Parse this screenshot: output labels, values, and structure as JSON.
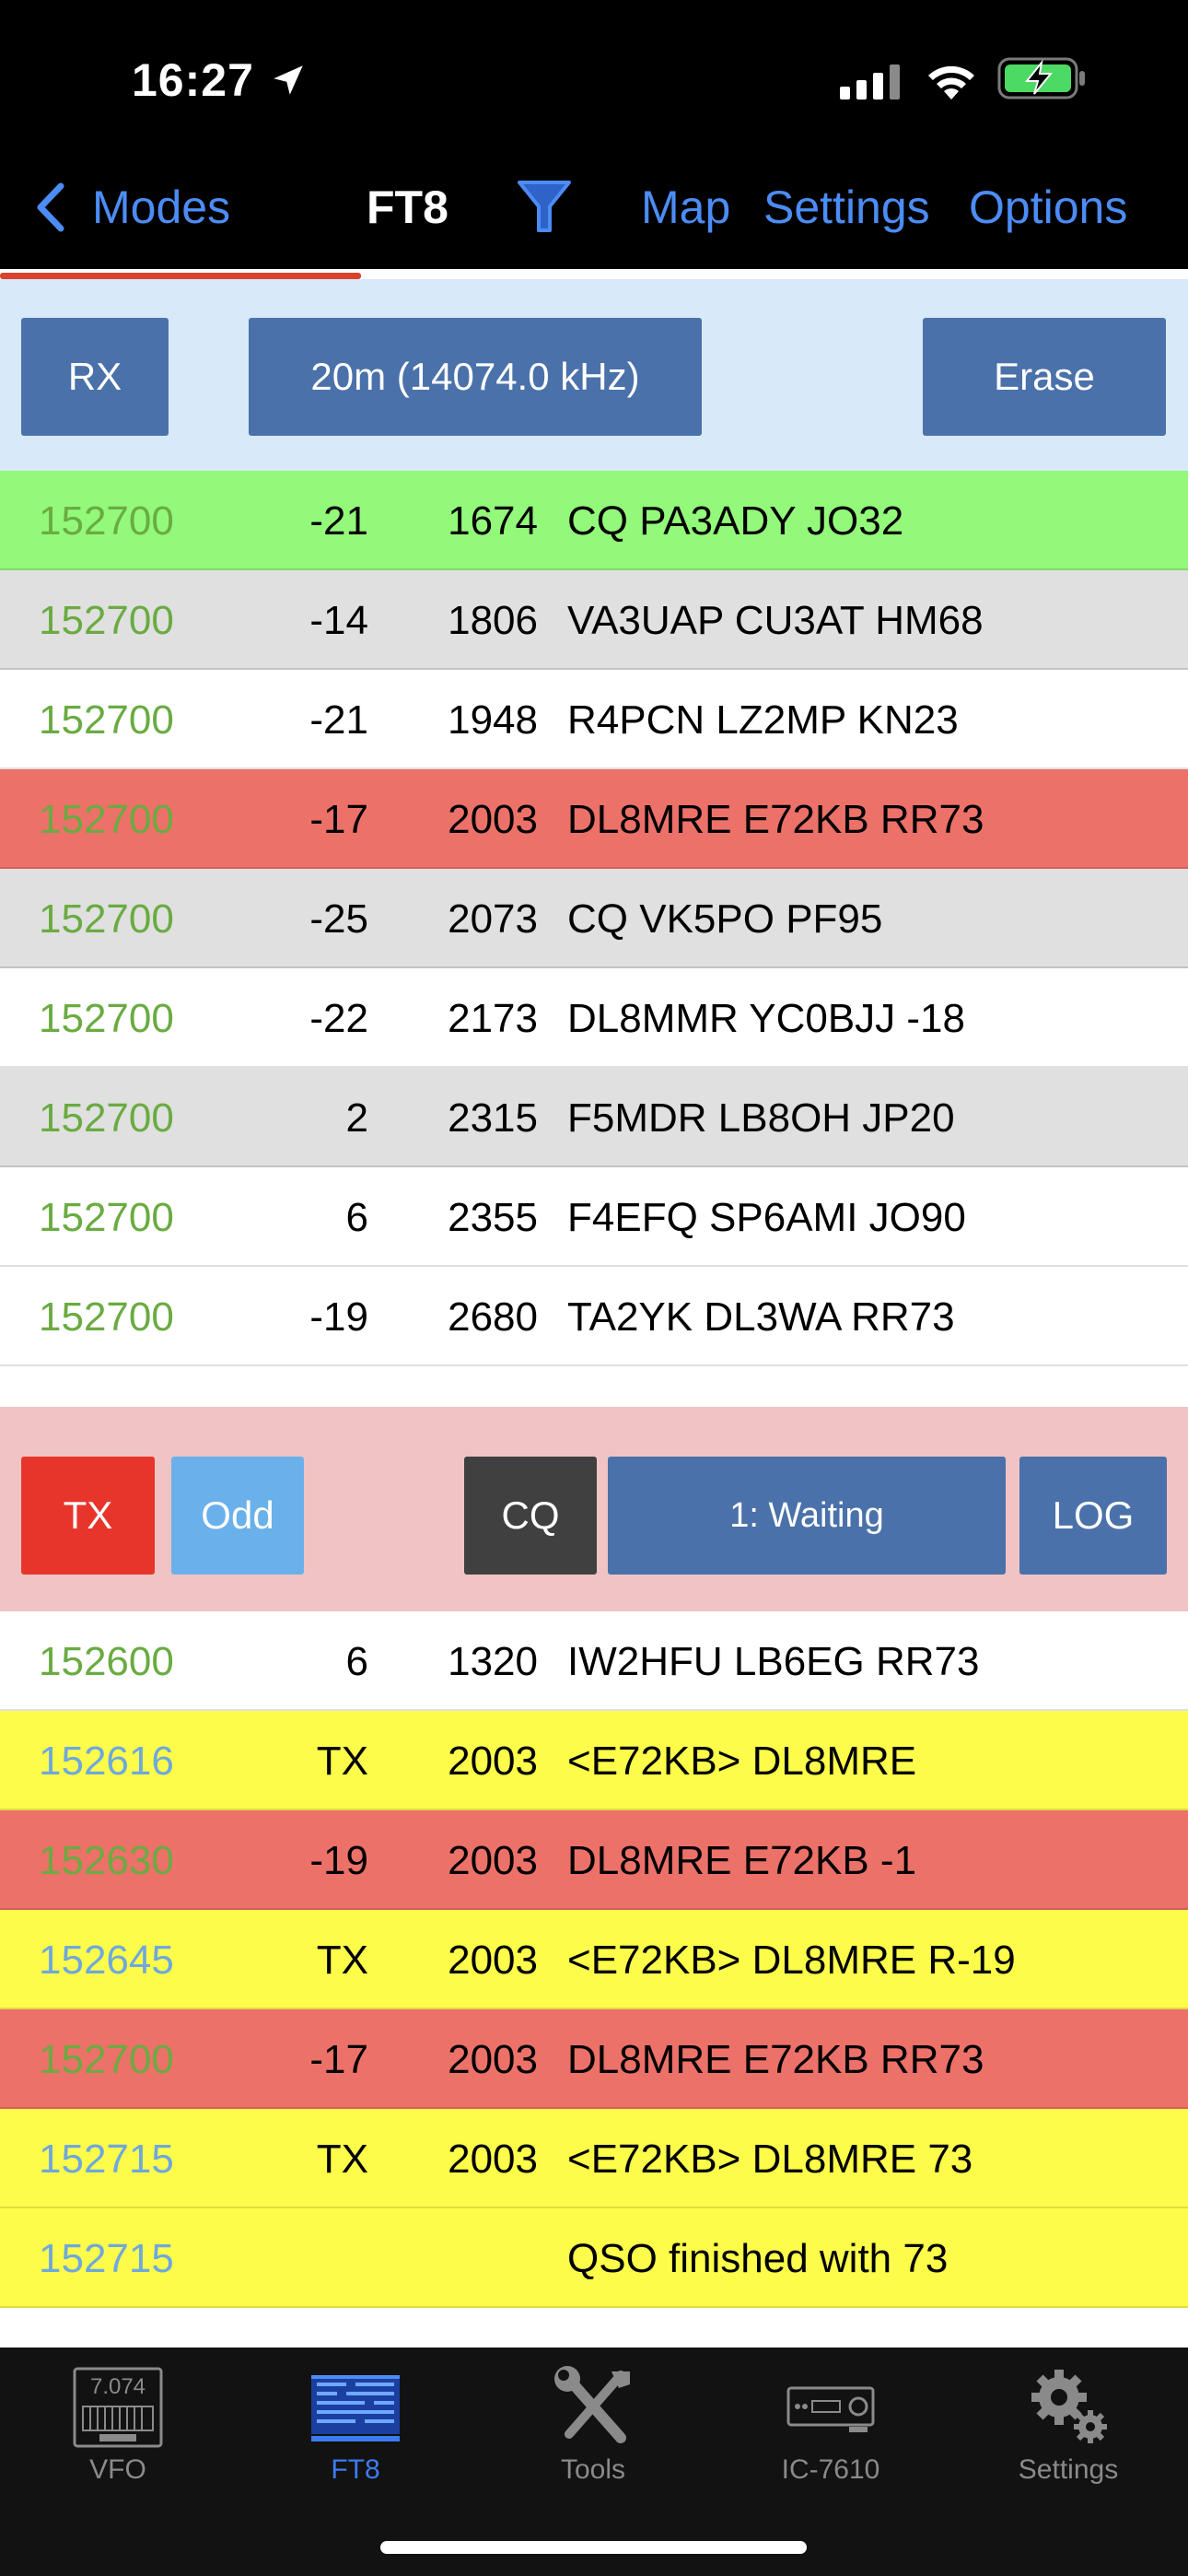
{
  "status_bar": {
    "time": "16:27"
  },
  "nav": {
    "back_label": "Modes",
    "title": "FT8",
    "map": "Map",
    "settings": "Settings",
    "options": "Options"
  },
  "rx_panel": {
    "rx_button": "RX",
    "band_button": "20m (14074.0 kHz)",
    "erase_button": "Erase"
  },
  "rx_rows": [
    {
      "time": "152700",
      "db": "-21",
      "df": "1674",
      "msg": "CQ PA3ADY JO32",
      "bg": "#93F97A",
      "time_color": "green"
    },
    {
      "time": "152700",
      "db": "-14",
      "df": "1806",
      "msg": "VA3UAP CU3AT HM68",
      "bg": "#E0E0E0",
      "time_color": "green"
    },
    {
      "time": "152700",
      "db": "-21",
      "df": "1948",
      "msg": "R4PCN LZ2MP KN23",
      "bg": "#FFFFFF",
      "time_color": "green"
    },
    {
      "time": "152700",
      "db": "-17",
      "df": "2003",
      "msg": "DL8MRE E72KB RR73",
      "bg": "#EC7169",
      "time_color": "green"
    },
    {
      "time": "152700",
      "db": "-25",
      "df": "2073",
      "msg": "CQ VK5PO PF95",
      "bg": "#E0E0E0",
      "time_color": "green"
    },
    {
      "time": "152700",
      "db": "-22",
      "df": "2173",
      "msg": "DL8MMR YC0BJJ -18",
      "bg": "#FFFFFF",
      "time_color": "green"
    },
    {
      "time": "152700",
      "db": "2",
      "df": "2315",
      "msg": "F5MDR LB8OH JP20",
      "bg": "#E0E0E0",
      "time_color": "green"
    },
    {
      "time": "152700",
      "db": "6",
      "df": "2355",
      "msg": "F4EFQ SP6AMI JO90",
      "bg": "#FFFFFF",
      "time_color": "green"
    },
    {
      "time": "152700",
      "db": "-19",
      "df": "2680",
      "msg": "TA2YK DL3WA RR73",
      "bg": "#FFFFFF",
      "time_color": "green"
    }
  ],
  "tx_panel": {
    "tx_button": "TX",
    "odd_button": "Odd",
    "cq_button": "CQ",
    "state_button": "1: Waiting",
    "log_button": "LOG"
  },
  "tx_rows": [
    {
      "time": "152600",
      "db": "6",
      "df": "1320",
      "msg": "IW2HFU LB6EG RR73",
      "bg": "#FFFFFF",
      "time_color": "green"
    },
    {
      "time": "152616",
      "db": "TX",
      "df": "2003",
      "msg": "<E72KB> DL8MRE",
      "bg": "#FDFC4A",
      "time_color": "blue"
    },
    {
      "time": "152630",
      "db": "-19",
      "df": "2003",
      "msg": "DL8MRE E72KB -1",
      "bg": "#EC7169",
      "time_color": "green"
    },
    {
      "time": "152645",
      "db": "TX",
      "df": "2003",
      "msg": "<E72KB> DL8MRE R-19",
      "bg": "#FDFC4A",
      "time_color": "blue"
    },
    {
      "time": "152700",
      "db": "-17",
      "df": "2003",
      "msg": "DL8MRE E72KB RR73",
      "bg": "#EC7169",
      "time_color": "green"
    },
    {
      "time": "152715",
      "db": "TX",
      "df": "2003",
      "msg": "<E72KB> DL8MRE 73",
      "bg": "#FDFC4A",
      "time_color": "blue"
    },
    {
      "time": "152715",
      "db": "",
      "df": "",
      "msg": "QSO finished with 73",
      "bg": "#FDFC4A",
      "time_color": "blue"
    }
  ],
  "tabs": [
    {
      "label": "VFO",
      "icon": "vfo-display-icon",
      "vfo_value": "7.074"
    },
    {
      "label": "FT8",
      "icon": "waterfall-icon"
    },
    {
      "label": "Tools",
      "icon": "tools-icon"
    },
    {
      "label": "IC-7610",
      "icon": "radio-icon"
    },
    {
      "label": "Settings",
      "icon": "gears-icon"
    }
  ],
  "colors": {
    "accent": "#4C8CF5",
    "button_blue": "#4A71A9",
    "tx_red": "#E8352B",
    "odd_blue": "#6AB0EA",
    "cq_dark": "#404040",
    "rx_panel_bg": "#D8E9F9",
    "tx_panel_bg": "#F0C4C4"
  }
}
